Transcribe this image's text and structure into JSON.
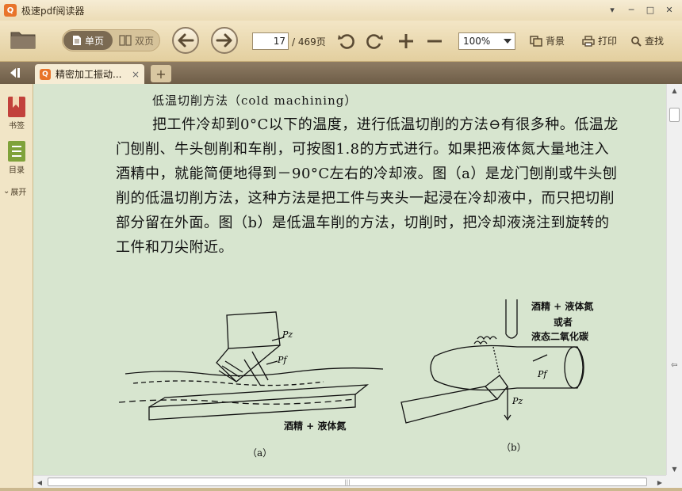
{
  "window": {
    "title": "极速pdf阅读器",
    "logo_glyph": "Q"
  },
  "window_controls": {
    "menu": "▾",
    "minimize": "─",
    "maximize": "□",
    "close": "✕"
  },
  "toolbar": {
    "single_page": "单页",
    "double_page": "双页",
    "current_page": "17",
    "total_pages": "/ 469页",
    "zoom": "100%",
    "background": "背景",
    "print": "打印",
    "search": "查找"
  },
  "tabs": [
    {
      "label": "精密加工振动...",
      "close": "×"
    }
  ],
  "new_tab": "+",
  "side_panel": {
    "bookmarks": "书签",
    "toc": "目录",
    "expand": "展开"
  },
  "document": {
    "heading": "低温切削方法（cold machining）",
    "paragraph": "把工件冷却到0°C以下的温度，进行低温切削的方法⊖有很多种。低温龙门刨削、牛头刨削和车削，可按图1.8的方式进行。如果把液体氮大量地注入酒精中，就能简便地得到－90°C左右的冷却液。图（a）是龙门刨削或牛头刨削的低温切削方法，这种方法是把工件与夹头一起浸在冷却液中，而只把切削部分留在外面。图（b）是低温车削的方法，切削时，把冷却液浇注到旋转的工件和刀尖附近。",
    "figure_a": {
      "caption": "（a）",
      "note": "酒精 + 液体氮",
      "label_pz": "Pz",
      "label_pf": "Pf"
    },
    "figure_b": {
      "caption": "（b）",
      "note_line1": "酒精 + 液体氮",
      "note_line2": "或者",
      "note_line3": "液态二氧化碳",
      "label_pf": "Pf",
      "label_pz": "Pz"
    }
  },
  "colors": {
    "accent": "#e8742a",
    "page_bg": "#d7e5cf",
    "toolbar_bg": "#e3cf9f",
    "tabbar_bg": "#7b6a52"
  }
}
